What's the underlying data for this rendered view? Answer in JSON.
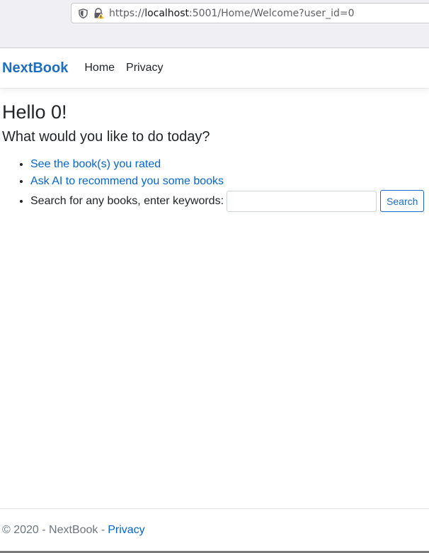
{
  "browser": {
    "url_prefix": "https://",
    "url_host": "localhost",
    "url_rest": ":5001/Home/Welcome?user_id=0"
  },
  "navbar": {
    "brand": "NextBook",
    "links": [
      {
        "label": "Home"
      },
      {
        "label": "Privacy"
      }
    ]
  },
  "main": {
    "greeting": "Hello 0!",
    "question": "What would you like to do today?",
    "actions": [
      {
        "label": "See the book(s) you rated"
      },
      {
        "label": "Ask AI to recommend you some books"
      }
    ],
    "search": {
      "label": "Search for any books, enter keywords:",
      "value": "",
      "button_label": "Search"
    }
  },
  "footer": {
    "copyright": "© 2020 - NextBook -",
    "privacy_link": "Privacy"
  },
  "colors": {
    "brand": "#1b6ec2",
    "link": "#0366d6",
    "footer_text": "#6c757d"
  }
}
